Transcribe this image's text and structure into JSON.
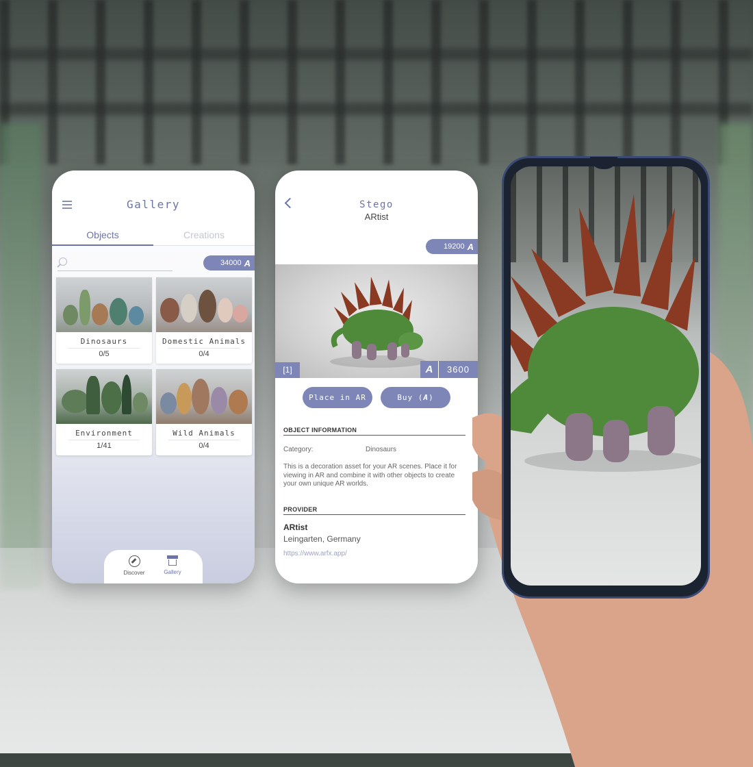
{
  "gallery_screen": {
    "title": "Gallery",
    "tabs": [
      {
        "label": "Objects"
      },
      {
        "label": "Creations"
      }
    ],
    "search_placeholder": "",
    "coins": "34000",
    "categories": [
      {
        "name": "Dinosaurs",
        "count": "0/5"
      },
      {
        "name": "Domestic Animals",
        "count": "0/4"
      },
      {
        "name": "Environment",
        "count": "1/41"
      },
      {
        "name": "Wild Animals",
        "count": "0/4"
      }
    ],
    "nav": {
      "discover": "Discover",
      "gallery": "Gallery"
    }
  },
  "detail_screen": {
    "title": "Stego",
    "subtitle": "ARtist",
    "coins": "19200",
    "item_count": "[1]",
    "price": "3600",
    "place_ar_label": "Place in AR",
    "buy_label": "Buy (",
    "buy_suffix": ")",
    "object_info_heading": "OBJECT INFORMATION",
    "category_label": "Category:",
    "category_value": "Dinosaurs",
    "description": "This is a decoration asset for your AR scenes. Place it for viewing in AR and combine it with other objects to create your own unique AR worlds.",
    "provider_heading": "PROVIDER",
    "provider_name": "ARtist",
    "provider_location": "Leingarten, Germany",
    "provider_url": "https://www.arfx.app/"
  },
  "icons": {
    "menu": "menu-icon",
    "search": "search-icon",
    "coin": "a-coin-icon",
    "discover": "compass-icon",
    "gallery": "store-icon",
    "back": "chevron-left-icon"
  },
  "colors": {
    "accent": "#6b73a8",
    "badge": "#7d86b7",
    "dino_green": "#4e8a3a",
    "dino_plates": "#8a3a22"
  }
}
